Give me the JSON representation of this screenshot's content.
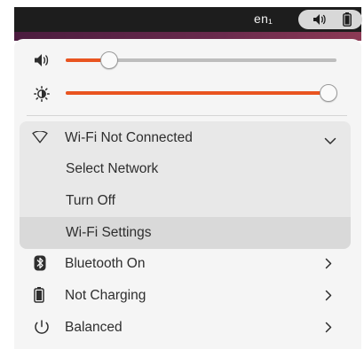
{
  "topbar": {
    "keyboard_layout": "en₁",
    "status_icons": [
      "volume-icon",
      "battery-icon"
    ]
  },
  "sliders": {
    "volume": {
      "icon": "volume-icon",
      "level": 0.16
    },
    "brightness": {
      "icon": "brightness-icon",
      "level": 0.97
    }
  },
  "wifi": {
    "label": "Wi-Fi Not Connected",
    "icon": "wifi-icon",
    "expanded": true,
    "items": [
      {
        "label": "Select Network"
      },
      {
        "label": "Turn Off"
      },
      {
        "label": "Wi-Fi Settings"
      }
    ]
  },
  "menu": [
    {
      "label": "Bluetooth On",
      "icon": "bluetooth-icon"
    },
    {
      "label": "Not Charging",
      "icon": "battery-icon"
    },
    {
      "label": "Balanced",
      "icon": "power-mode-icon"
    }
  ],
  "colors": {
    "accent": "#e95420",
    "panel": "#f5f5f5",
    "topbar": "#1d1d1d"
  }
}
